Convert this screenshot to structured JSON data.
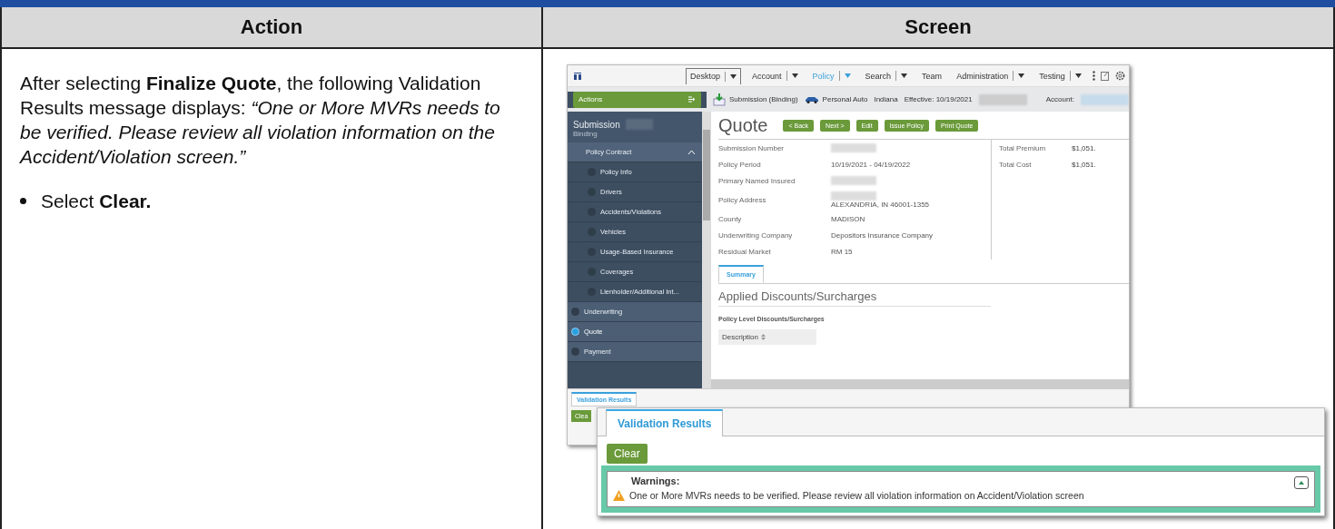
{
  "table": {
    "columns": [
      "Action",
      "Screen"
    ]
  },
  "action": {
    "intro": "After selecting **Finalize Quote**, the following Validation Results message displays: *“One or More MVRs needs to be verified. Please review all violation information on the Accident/Violation screen.”*",
    "bullets": [
      "Select **Clear.**"
    ]
  },
  "screen": {
    "nav": [
      {
        "label": "Desktop",
        "selected": false,
        "dropdown": true
      },
      {
        "label": "Account",
        "selected": false,
        "dropdown": true
      },
      {
        "label": "Policy",
        "selected": true,
        "dropdown": true
      },
      {
        "label": "Search",
        "selected": false,
        "dropdown": true
      },
      {
        "label": "Team",
        "selected": false,
        "dropdown": false
      },
      {
        "label": "Administration",
        "selected": false,
        "dropdown": true
      },
      {
        "label": "Testing",
        "selected": false,
        "dropdown": true
      }
    ],
    "info_bar": {
      "job": "Submission (Binding)",
      "product": "Personal Auto",
      "state": "Indiana",
      "effective": "Effective: 10/19/2021",
      "account_label": "Account:"
    },
    "sidebar": {
      "actions": "Actions",
      "title": "Submission",
      "subtitle": "Binding",
      "items": [
        {
          "label": "Policy Contract",
          "kind": "group",
          "expanded": true,
          "selected": false,
          "children": [
            {
              "label": "Policy Info",
              "kind": "step",
              "selected": false
            },
            {
              "label": "Drivers",
              "kind": "step",
              "selected": false
            },
            {
              "label": "Accidents/Violations",
              "kind": "step",
              "selected": false
            },
            {
              "label": "Vehicles",
              "kind": "step",
              "selected": false
            },
            {
              "label": "Usage-Based Insurance",
              "kind": "step",
              "selected": false
            },
            {
              "label": "Coverages",
              "kind": "step",
              "selected": false
            },
            {
              "label": "Lienholder/Additional Int...",
              "kind": "step",
              "selected": false
            }
          ]
        },
        {
          "label": "Underwriting",
          "kind": "top",
          "selected": false
        },
        {
          "label": "Quote",
          "kind": "top",
          "selected": true
        },
        {
          "label": "Payment",
          "kind": "top",
          "selected": false
        }
      ]
    },
    "page_title": "Quote",
    "buttons": [
      "< Back",
      "Next >",
      "Edit",
      "Issue Policy",
      "Print Quote"
    ],
    "fields": [
      {
        "label": "Submission Number",
        "redacted": true
      },
      {
        "label": "Policy Period",
        "value": "10/19/2021 - 04/19/2022",
        "redacted": false
      },
      {
        "label": "Primary Named Insured",
        "redacted": true
      },
      {
        "label": "Policy Address",
        "value": "ALEXANDRIA, IN 46001-1355",
        "redacted": true
      },
      {
        "label": "County",
        "value": "MADISON",
        "redacted": false
      },
      {
        "label": "Underwriting Company",
        "value": "Depositors Insurance Company",
        "redacted": false
      },
      {
        "label": "Residual Market",
        "value": "RM 15",
        "redacted": false
      }
    ],
    "totals": [
      {
        "label": "Total Premium",
        "value": "$1,051."
      },
      {
        "label": "Total Cost",
        "value": "$1,051."
      }
    ],
    "tabs": [
      {
        "label": "Summary",
        "selected": true
      }
    ],
    "section_title": "Applied Discounts/Surcharges",
    "subsection_title": "Policy Level Discounts/Surcharges",
    "column": "Description",
    "bottom_tab": {
      "label": "Validation Results",
      "selected": true
    },
    "bottom_button": "Clea"
  },
  "callout": {
    "tab": {
      "label": "Validation Results",
      "selected": true
    },
    "button": "Clear",
    "heading": "Warnings:",
    "message": "One or More MVRs needs to be verified. Please review all violation information on Accident/Violation screen"
  }
}
